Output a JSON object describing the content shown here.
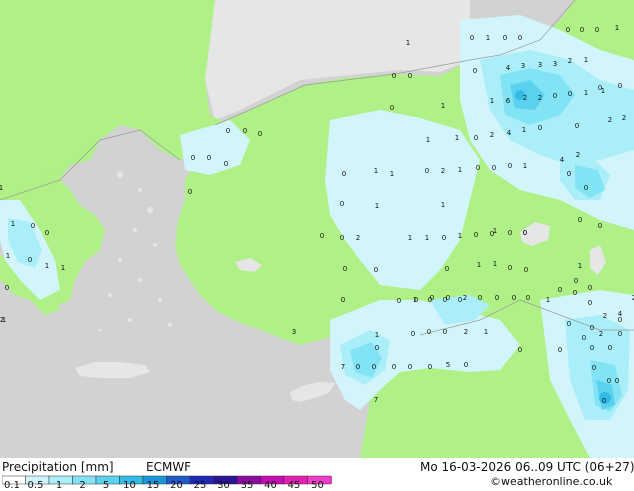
{
  "footer": {
    "title": "Precipitation [mm]",
    "model": "ECMWF",
    "datetime": "Mo 16-03-2026 06..09 UTC (06+27)",
    "credit": "©weatheronline.co.uk"
  },
  "legend": {
    "ticks": [
      "0.1",
      "0.5",
      "1",
      "2",
      "5",
      "10",
      "15",
      "20",
      "25",
      "30",
      "35",
      "40",
      "45",
      "50"
    ],
    "colors": [
      "#ffffff",
      "#d2f5fb",
      "#aaeefa",
      "#82e3f5",
      "#5ad2ef",
      "#32bbe6",
      "#1a96d8",
      "#1e5ac8",
      "#1e28b4",
      "#281496",
      "#8c0aa0",
      "#c80ab4",
      "#e61eb4",
      "#f03cc8"
    ]
  },
  "map": {
    "colors": {
      "sea": "#d2d2d2",
      "land": "#aff087",
      "grey_land": "#e6e6e6",
      "precip_light": "#d2f5fb",
      "precip_med": "#aaeefa",
      "precip_mod": "#82e3f5",
      "precip_heavy": "#5ad2ef",
      "precip_strong": "#32bbe6",
      "precip_max": "#1a96d8"
    },
    "values": [
      {
        "t": "1"
      },
      {
        "t": "0"
      },
      {
        "t": "1"
      },
      {
        "t": "0"
      },
      {
        "t": "0"
      },
      {
        "t": "0"
      },
      {
        "t": "0"
      },
      {
        "t": "0"
      },
      {
        "t": "1"
      },
      {
        "t": "0"
      },
      {
        "t": "4"
      },
      {
        "t": "3"
      },
      {
        "t": "3"
      },
      {
        "t": "3"
      },
      {
        "t": "2"
      },
      {
        "t": "1"
      },
      {
        "t": "0"
      },
      {
        "t": "0"
      },
      {
        "t": "0"
      },
      {
        "t": "0"
      },
      {
        "t": "1"
      },
      {
        "t": "6"
      },
      {
        "t": "2"
      },
      {
        "t": "2"
      },
      {
        "t": "0"
      },
      {
        "t": "0"
      },
      {
        "t": "1"
      },
      {
        "t": "1"
      },
      {
        "t": "0"
      },
      {
        "t": "0"
      },
      {
        "t": "0"
      },
      {
        "t": "1"
      },
      {
        "t": "2"
      },
      {
        "t": "2"
      },
      {
        "t": "0"
      },
      {
        "t": "1"
      },
      {
        "t": "1"
      },
      {
        "t": "0"
      },
      {
        "t": "2"
      },
      {
        "t": "4"
      },
      {
        "t": "1"
      },
      {
        "t": "0"
      },
      {
        "t": "0"
      },
      {
        "t": "0"
      },
      {
        "t": "0"
      },
      {
        "t": "0"
      },
      {
        "t": "4"
      },
      {
        "t": "2"
      },
      {
        "t": "1"
      },
      {
        "t": "1"
      },
      {
        "t": "0"
      },
      {
        "t": "2"
      },
      {
        "t": "1"
      },
      {
        "t": "0"
      },
      {
        "t": "0"
      },
      {
        "t": "0"
      },
      {
        "t": "1"
      },
      {
        "t": "0"
      },
      {
        "t": "0"
      },
      {
        "t": "0"
      },
      {
        "t": "0"
      },
      {
        "t": "1"
      },
      {
        "t": "1"
      },
      {
        "t": "0"
      },
      {
        "t": "1"
      },
      {
        "t": "1"
      },
      {
        "t": "0"
      },
      {
        "t": "0"
      },
      {
        "t": "1"
      },
      {
        "t": "0"
      },
      {
        "t": "0"
      },
      {
        "t": "0"
      },
      {
        "t": "0"
      },
      {
        "t": "0"
      },
      {
        "t": "2"
      },
      {
        "t": "1"
      },
      {
        "t": "1"
      },
      {
        "t": "0"
      },
      {
        "t": "1"
      },
      {
        "t": "0"
      },
      {
        "t": "0"
      },
      {
        "t": "0"
      },
      {
        "t": "0"
      },
      {
        "t": "1"
      },
      {
        "t": "0"
      },
      {
        "t": "1"
      },
      {
        "t": "1"
      },
      {
        "t": "1"
      },
      {
        "t": "0"
      },
      {
        "t": "0"
      },
      {
        "t": "0"
      },
      {
        "t": "1"
      },
      {
        "t": "1"
      },
      {
        "t": "0"
      },
      {
        "t": "0"
      },
      {
        "t": "0"
      },
      {
        "t": "0"
      },
      {
        "t": "0"
      },
      {
        "t": "0"
      },
      {
        "t": "0"
      },
      {
        "t": "0"
      },
      {
        "t": "0"
      },
      {
        "t": "0"
      },
      {
        "t": "0"
      },
      {
        "t": "0"
      },
      {
        "t": "0"
      },
      {
        "t": "2"
      },
      {
        "t": "4"
      },
      {
        "t": "2"
      },
      {
        "t": "1"
      },
      {
        "t": "0"
      },
      {
        "t": "1"
      },
      {
        "t": "0"
      },
      {
        "t": "0"
      },
      {
        "t": "2"
      },
      {
        "t": "0"
      },
      {
        "t": "0"
      },
      {
        "t": "0"
      },
      {
        "t": "0"
      },
      {
        "t": "1"
      },
      {
        "t": "0"
      },
      {
        "t": "2"
      },
      {
        "t": "3"
      },
      {
        "t": "1"
      },
      {
        "t": "0"
      },
      {
        "t": "0"
      },
      {
        "t": "0"
      },
      {
        "t": "2"
      },
      {
        "t": "1"
      },
      {
        "t": "0"
      },
      {
        "t": "0"
      },
      {
        "t": "0"
      },
      {
        "t": "0"
      },
      {
        "t": "0"
      },
      {
        "t": "0"
      },
      {
        "t": "0"
      },
      {
        "t": "0"
      },
      {
        "t": "2"
      },
      {
        "t": "0"
      },
      {
        "t": "7"
      },
      {
        "t": "0"
      },
      {
        "t": "0"
      },
      {
        "t": "0"
      },
      {
        "t": "0"
      },
      {
        "t": "0"
      },
      {
        "t": "5"
      },
      {
        "t": "0"
      },
      {
        "t": "0"
      },
      {
        "t": "0"
      },
      {
        "t": "7"
      },
      {
        "t": "0"
      },
      {
        "t": "0"
      }
    ]
  }
}
